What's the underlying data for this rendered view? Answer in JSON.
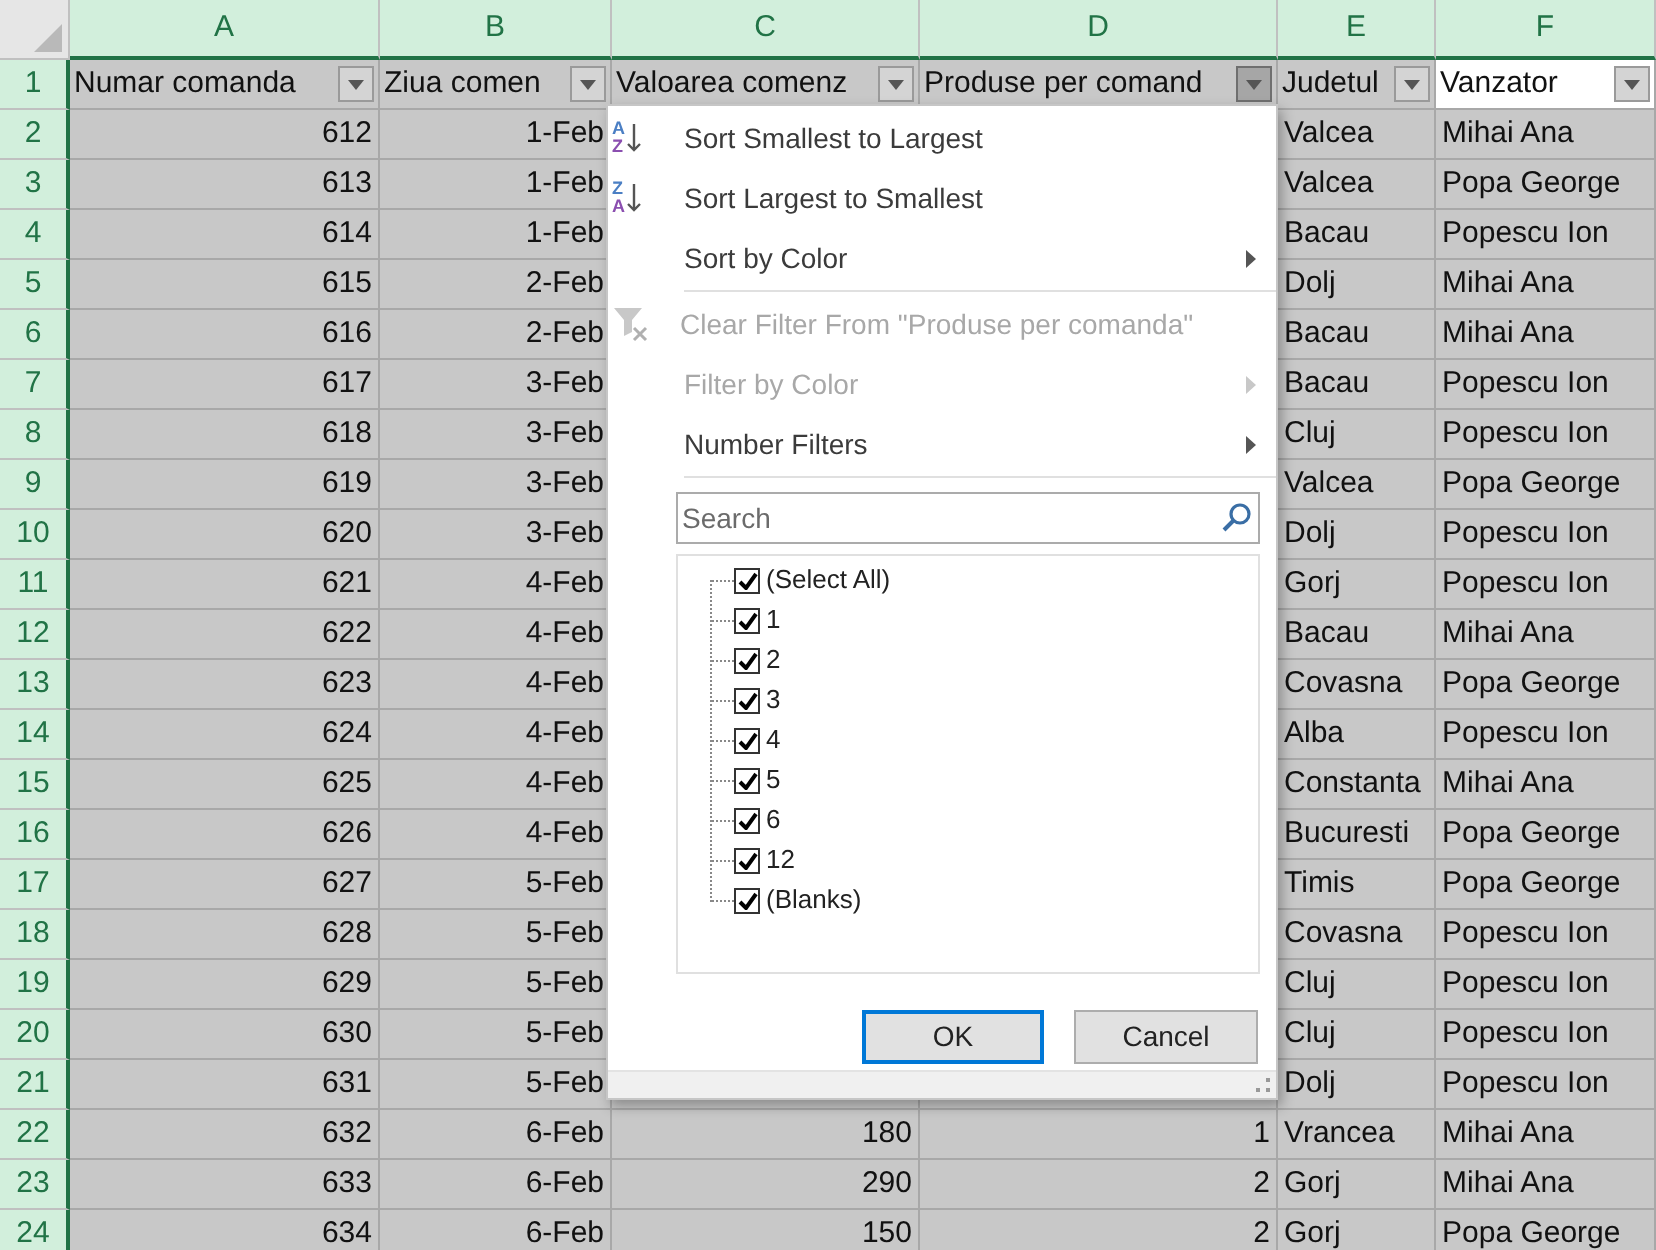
{
  "columns": [
    {
      "letter": "A",
      "selected": true
    },
    {
      "letter": "B",
      "selected": true
    },
    {
      "letter": "C",
      "selected": true
    },
    {
      "letter": "D",
      "selected": true
    },
    {
      "letter": "E",
      "selected": true
    },
    {
      "letter": "F",
      "selected": true
    }
  ],
  "header_row": {
    "number": "1",
    "cells": [
      {
        "text": "Numar comanda",
        "filter_active": false,
        "active_cell": false
      },
      {
        "text": "Ziua comen",
        "filter_active": false,
        "active_cell": false
      },
      {
        "text": "Valoarea comenz",
        "filter_active": false,
        "active_cell": false
      },
      {
        "text": "Produse per comand",
        "filter_active": true,
        "active_cell": false
      },
      {
        "text": "Judetul",
        "filter_active": false,
        "active_cell": false
      },
      {
        "text": "Vanzator",
        "filter_active": false,
        "active_cell": true
      }
    ]
  },
  "rows": [
    {
      "number": "2",
      "a": "612",
      "b": "1-Feb",
      "e": "Valcea",
      "f": "Mihai Ana"
    },
    {
      "number": "3",
      "a": "613",
      "b": "1-Feb",
      "e": "Valcea",
      "f": "Popa George"
    },
    {
      "number": "4",
      "a": "614",
      "b": "1-Feb",
      "e": "Bacau",
      "f": "Popescu Ion"
    },
    {
      "number": "5",
      "a": "615",
      "b": "2-Feb",
      "e": "Dolj",
      "f": "Mihai Ana"
    },
    {
      "number": "6",
      "a": "616",
      "b": "2-Feb",
      "e": "Bacau",
      "f": "Mihai Ana"
    },
    {
      "number": "7",
      "a": "617",
      "b": "3-Feb",
      "e": "Bacau",
      "f": "Popescu Ion"
    },
    {
      "number": "8",
      "a": "618",
      "b": "3-Feb",
      "e": "Cluj",
      "f": "Popescu Ion"
    },
    {
      "number": "9",
      "a": "619",
      "b": "3-Feb",
      "e": "Valcea",
      "f": "Popa George"
    },
    {
      "number": "10",
      "a": "620",
      "b": "3-Feb",
      "e": "Dolj",
      "f": "Popescu Ion"
    },
    {
      "number": "11",
      "a": "621",
      "b": "4-Feb",
      "e": "Gorj",
      "f": "Popescu Ion"
    },
    {
      "number": "12",
      "a": "622",
      "b": "4-Feb",
      "e": "Bacau",
      "f": "Mihai Ana"
    },
    {
      "number": "13",
      "a": "623",
      "b": "4-Feb",
      "e": "Covasna",
      "f": "Popa George"
    },
    {
      "number": "14",
      "a": "624",
      "b": "4-Feb",
      "e": "Alba",
      "f": "Popescu Ion"
    },
    {
      "number": "15",
      "a": "625",
      "b": "4-Feb",
      "e": "Constanta",
      "f": "Mihai Ana"
    },
    {
      "number": "16",
      "a": "626",
      "b": "4-Feb",
      "e": "Bucuresti",
      "f": "Popa George"
    },
    {
      "number": "17",
      "a": "627",
      "b": "5-Feb",
      "e": "Timis",
      "f": "Popa George"
    },
    {
      "number": "18",
      "a": "628",
      "b": "5-Feb",
      "e": "Covasna",
      "f": "Popescu Ion"
    },
    {
      "number": "19",
      "a": "629",
      "b": "5-Feb",
      "e": "Cluj",
      "f": "Popescu Ion"
    },
    {
      "number": "20",
      "a": "630",
      "b": "5-Feb",
      "e": "Cluj",
      "f": "Popescu Ion"
    },
    {
      "number": "21",
      "a": "631",
      "b": "5-Feb",
      "e": "Dolj",
      "f": "Popescu Ion"
    },
    {
      "number": "22",
      "a": "632",
      "b": "6-Feb",
      "c": "180",
      "d": "1",
      "e": "Vrancea",
      "f": "Mihai Ana"
    },
    {
      "number": "23",
      "a": "633",
      "b": "6-Feb",
      "c": "290",
      "d": "2",
      "e": "Gorj",
      "f": "Mihai Ana"
    },
    {
      "number": "24",
      "a": "634",
      "b": "6-Feb",
      "c": "150",
      "d": "2",
      "e": "Gorj",
      "f": "Popa George"
    }
  ],
  "filter_menu": {
    "items": [
      {
        "kind": "sort",
        "label": "Sort Smallest to Largest",
        "icon_letters": [
          "A",
          "Z"
        ],
        "disabled": false,
        "submenu": false
      },
      {
        "kind": "sort",
        "label": "Sort Largest to Smallest",
        "icon_letters": [
          "Z",
          "A"
        ],
        "disabled": false,
        "submenu": false
      },
      {
        "kind": "plain",
        "label": "Sort by Color",
        "disabled": false,
        "submenu": true
      },
      {
        "kind": "separator"
      },
      {
        "kind": "clear",
        "label": "Clear Filter From \"Produse per comanda\"",
        "disabled": true,
        "submenu": false
      },
      {
        "kind": "plain",
        "label": "Filter by Color",
        "disabled": true,
        "submenu": true
      },
      {
        "kind": "plain",
        "label": "Number Filters",
        "disabled": false,
        "submenu": true
      },
      {
        "kind": "separator"
      }
    ],
    "search": {
      "placeholder": "Search"
    },
    "values": [
      {
        "label": "(Select All)",
        "checked": true
      },
      {
        "label": "1",
        "checked": true
      },
      {
        "label": "2",
        "checked": true
      },
      {
        "label": "3",
        "checked": true
      },
      {
        "label": "4",
        "checked": true
      },
      {
        "label": "5",
        "checked": true
      },
      {
        "label": "6",
        "checked": true
      },
      {
        "label": "12",
        "checked": true
      },
      {
        "label": "(Blanks)",
        "checked": true
      }
    ],
    "buttons": [
      {
        "label": "OK",
        "default": true
      },
      {
        "label": "Cancel",
        "default": false
      }
    ]
  }
}
